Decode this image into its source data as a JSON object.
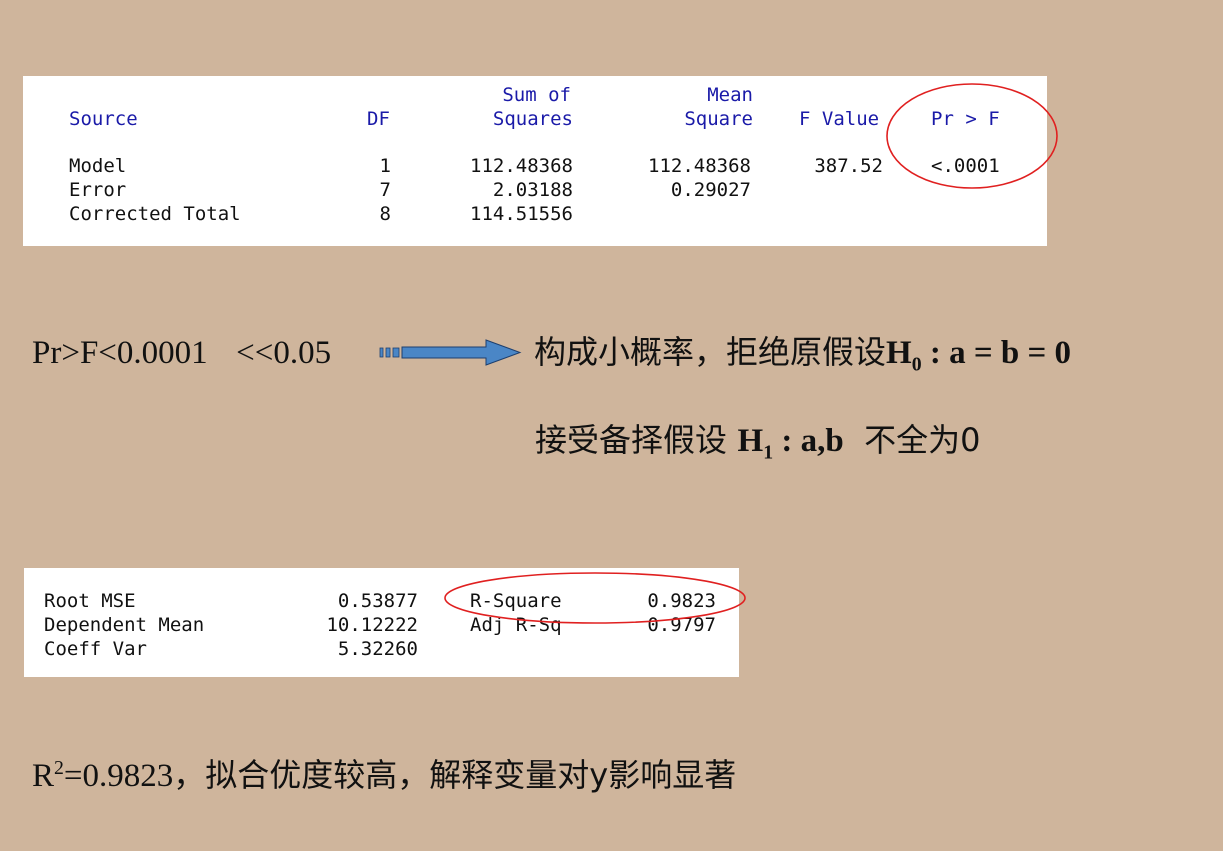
{
  "anova": {
    "headers": {
      "source": "Source",
      "df": "DF",
      "ss_line1": "Sum of",
      "ss_line2": "Squares",
      "ms_line1": "Mean",
      "ms_line2": "Square",
      "f": "F Value",
      "p": "Pr > F"
    },
    "rows": [
      {
        "source": "Model",
        "df": "1",
        "ss": "112.48368",
        "ms": "112.48368",
        "f": "387.52",
        "p": "<.0001"
      },
      {
        "source": "Error",
        "df": "7",
        "ss": "2.03188",
        "ms": "0.29027",
        "f": "",
        "p": ""
      },
      {
        "source": "Corrected Total",
        "df": "8",
        "ss": "114.51556",
        "ms": "",
        "f": "",
        "p": ""
      }
    ]
  },
  "conclusion1": {
    "pvalue_text": "Pr>F<0.0001",
    "compare_text": "<<0.05",
    "text": "构成小概率，拒绝原假设",
    "h0_label": "H",
    "h0_sub": "0",
    "h0_expr": " : a = b = 0"
  },
  "conclusion2": {
    "prefix": "接受备择假设",
    "h1_label": "H",
    "h1_sub": "1",
    "h1_expr": " : a,b",
    "suffix": "不全为0"
  },
  "fit": {
    "rows": [
      {
        "label": "Root MSE",
        "value": "0.53877",
        "label2": "R-Square",
        "value2": "0.9823"
      },
      {
        "label": "Dependent Mean",
        "value": "10.12222",
        "label2": "Adj R-Sq",
        "value2": "0.9797"
      },
      {
        "label": "Coeff Var",
        "value": "5.32260",
        "label2": "",
        "value2": ""
      }
    ]
  },
  "conclusion3": {
    "r": "R",
    "sup": "2",
    "value": "=0.9823",
    "text": "，拟合优度较高，解释变量对y影响显著"
  },
  "colors": {
    "background": "#cfb59c",
    "header_blue": "#1a1aa8",
    "circle_red": "#e02020",
    "arrow_blue": "#4a86c6"
  }
}
